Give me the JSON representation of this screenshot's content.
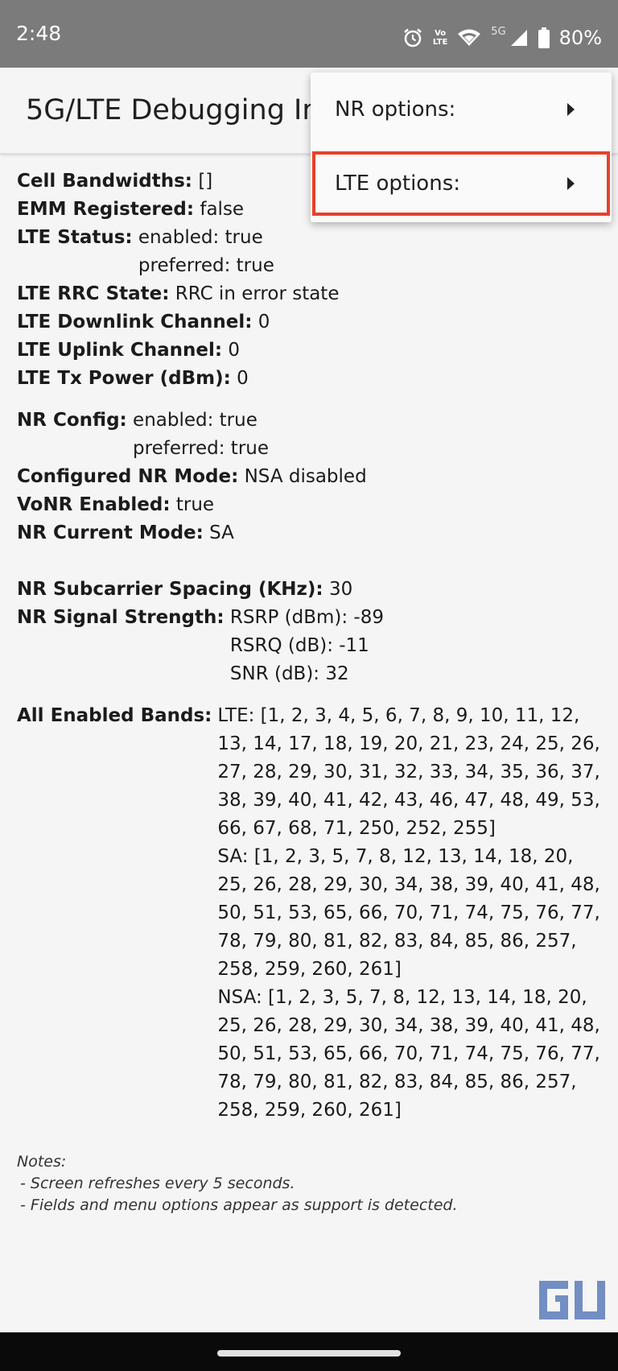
{
  "status_bar": {
    "time": "2:48",
    "volte_top": "Vo",
    "volte_bottom": "LTE",
    "network": "5G",
    "battery": "80%",
    "icons": [
      "alarm-icon",
      "volte-icon",
      "wifi-icon",
      "signal-icon",
      "battery-icon"
    ]
  },
  "app_bar": {
    "title": "5G/LTE Debugging Info"
  },
  "menu": {
    "items": [
      {
        "label": "NR options:",
        "icon": "chevron-right-icon"
      },
      {
        "label": "LTE options:",
        "icon": "chevron-right-icon"
      }
    ],
    "highlight_color": "#e8402a"
  },
  "info": {
    "cell_bandwidths": {
      "label": "Cell Bandwidths:",
      "value": "[]"
    },
    "emm_registered": {
      "label": "EMM Registered:",
      "value": "false"
    },
    "lte_status": {
      "label": "LTE Status:",
      "values": [
        "enabled: true",
        "preferred: true"
      ]
    },
    "lte_rrc_state": {
      "label": "LTE RRC State:",
      "value": "RRC in error state"
    },
    "lte_downlink_channel": {
      "label": "LTE Downlink Channel:",
      "value": "0"
    },
    "lte_uplink_channel": {
      "label": "LTE Uplink Channel:",
      "value": "0"
    },
    "lte_tx_power": {
      "label": "LTE Tx Power (dBm):",
      "value": "0"
    },
    "nr_config": {
      "label": "NR Config:",
      "values": [
        "enabled: true",
        "preferred: true"
      ]
    },
    "configured_nr_mode": {
      "label": "Configured NR Mode:",
      "value": "NSA disabled"
    },
    "vonr_enabled": {
      "label": "VoNR Enabled:",
      "value": "true"
    },
    "nr_current_mode": {
      "label": "NR Current Mode:",
      "value": "SA"
    },
    "nr_subcarrier_spacing": {
      "label": "NR Subcarrier Spacing (KHz):",
      "value": "30"
    },
    "nr_signal_strength": {
      "label": "NR Signal Strength:",
      "values": [
        "RSRP (dBm): -89",
        "RSRQ (dB): -11",
        "SNR (dB): 32"
      ]
    },
    "all_enabled_bands": {
      "label": "All Enabled Bands:",
      "lte": "LTE: [1, 2, 3, 4, 5, 6, 7, 8, 9, 10, 11, 12, 13, 14, 17, 18, 19, 20, 21, 23, 24, 25, 26, 27, 28, 29, 30, 31, 32, 33, 34, 35, 36, 37, 38, 39, 40, 41, 42, 43, 46, 47, 48, 49, 53, 66, 67, 68, 71, 250, 252, 255]",
      "sa": "SA: [1, 2, 3, 5, 7, 8, 12, 13, 14, 18, 20, 25, 26, 28, 29, 30, 34, 38, 39, 40, 41, 48, 50, 51, 53, 65, 66, 70, 71, 74, 75, 76, 77, 78, 79, 80, 81, 82, 83, 84, 85, 86, 257, 258, 259, 260, 261]",
      "nsa": "NSA: [1, 2, 3, 5, 7, 8, 12, 13, 14, 18, 20, 25, 26, 28, 29, 30, 34, 38, 39, 40, 41, 48, 50, 51, 53, 65, 66, 70, 71, 74, 75, 76, 77, 78, 79, 80, 81, 82, 83, 84, 85, 86, 257, 258, 259, 260, 261]"
    }
  },
  "notes": {
    "title": "Notes:",
    "lines": [
      "- Screen refreshes every 5 seconds.",
      "- Fields and menu options appear as support is detected."
    ]
  }
}
